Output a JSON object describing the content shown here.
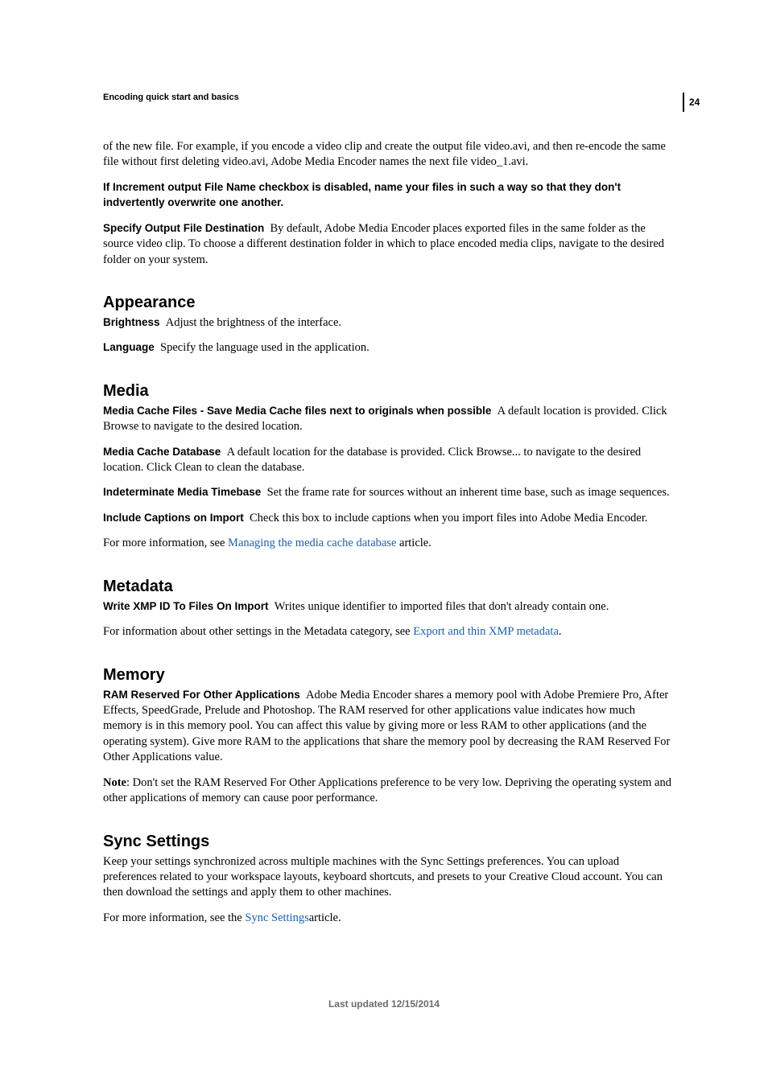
{
  "page_number": "24",
  "running_head": "Encoding quick start and basics",
  "intro_para": "of the new file. For example, if you encode a video clip and create the output file video.avi, and then re-encode the same file without first deleting video.avi, Adobe Media Encoder names the next file video_1.avi.",
  "increment_note": "If Increment output File Name checkbox is disabled, name your files in such a way so that they don't indvertently overwrite one another.",
  "specify_output_label": "Specify Output File Destination",
  "specify_output_text": "By default, Adobe Media Encoder places exported files in the same folder as the source video clip. To choose a different destination folder in which to place encoded media clips, navigate to the desired folder on your system.",
  "appearance": {
    "heading": "Appearance",
    "brightness_label": "Brightness",
    "brightness_text": "Adjust the brightness of the interface.",
    "language_label": "Language",
    "language_text": "Specify the language used in the application."
  },
  "media": {
    "heading": "Media",
    "cache_files_label": "Media Cache Files - Save Media Cache files next to originals when possible",
    "cache_files_text": "A default location is provided. Click Browse to navigate to the desired location.",
    "cache_db_label": "Media Cache Database",
    "cache_db_text": "A default location for the database is provided. Click Browse... to navigate to the desired location. Click Clean to clean the database.",
    "timebase_label": "Indeterminate Media Timebase",
    "timebase_text": "Set the frame rate for sources without an inherent time base, such as image sequences.",
    "captions_label": "Include Captions on Import",
    "captions_text": "Check this box to include captions when you import files into Adobe Media Encoder.",
    "more_info_pre": "For more information, see ",
    "more_info_link": "Managing the media cache database",
    "more_info_post": " article."
  },
  "metadata": {
    "heading": "Metadata",
    "xmp_label": "Write XMP ID To Files On Import",
    "xmp_text": "Writes unique identifier to imported files that don't already contain one.",
    "info_pre": "For information about other settings in the Metadata category, see ",
    "info_link": "Export and thin XMP metadata",
    "info_post": "."
  },
  "memory": {
    "heading": "Memory",
    "ram_label": "RAM Reserved For Other Applications",
    "ram_text": "Adobe Media Encoder shares a memory pool with Adobe Premiere Pro, After Effects, SpeedGrade, Prelude and Photoshop. The RAM reserved for other applications value indicates how much memory is in this memory pool. You can affect this value by giving more or less RAM to other applications (and the operating system). Give more RAM to the applications that share the memory pool by decreasing the RAM Reserved For Other Applications value.",
    "note_label": "Note",
    "note_text": ": Don't set the RAM Reserved For Other Applications preference to be very low. Depriving the operating system and other applications of memory can cause poor performance."
  },
  "sync": {
    "heading": "Sync Settings",
    "para": "Keep your settings synchronized across multiple machines with the Sync Settings preferences. You can upload preferences related to your workspace layouts, keyboard shortcuts, and presets to your Creative Cloud account. You can then download the settings and apply them to other machines.",
    "more_pre": "For more information, see the ",
    "more_link": "Sync Settings",
    "more_post": "article."
  },
  "footer": "Last updated 12/15/2014"
}
